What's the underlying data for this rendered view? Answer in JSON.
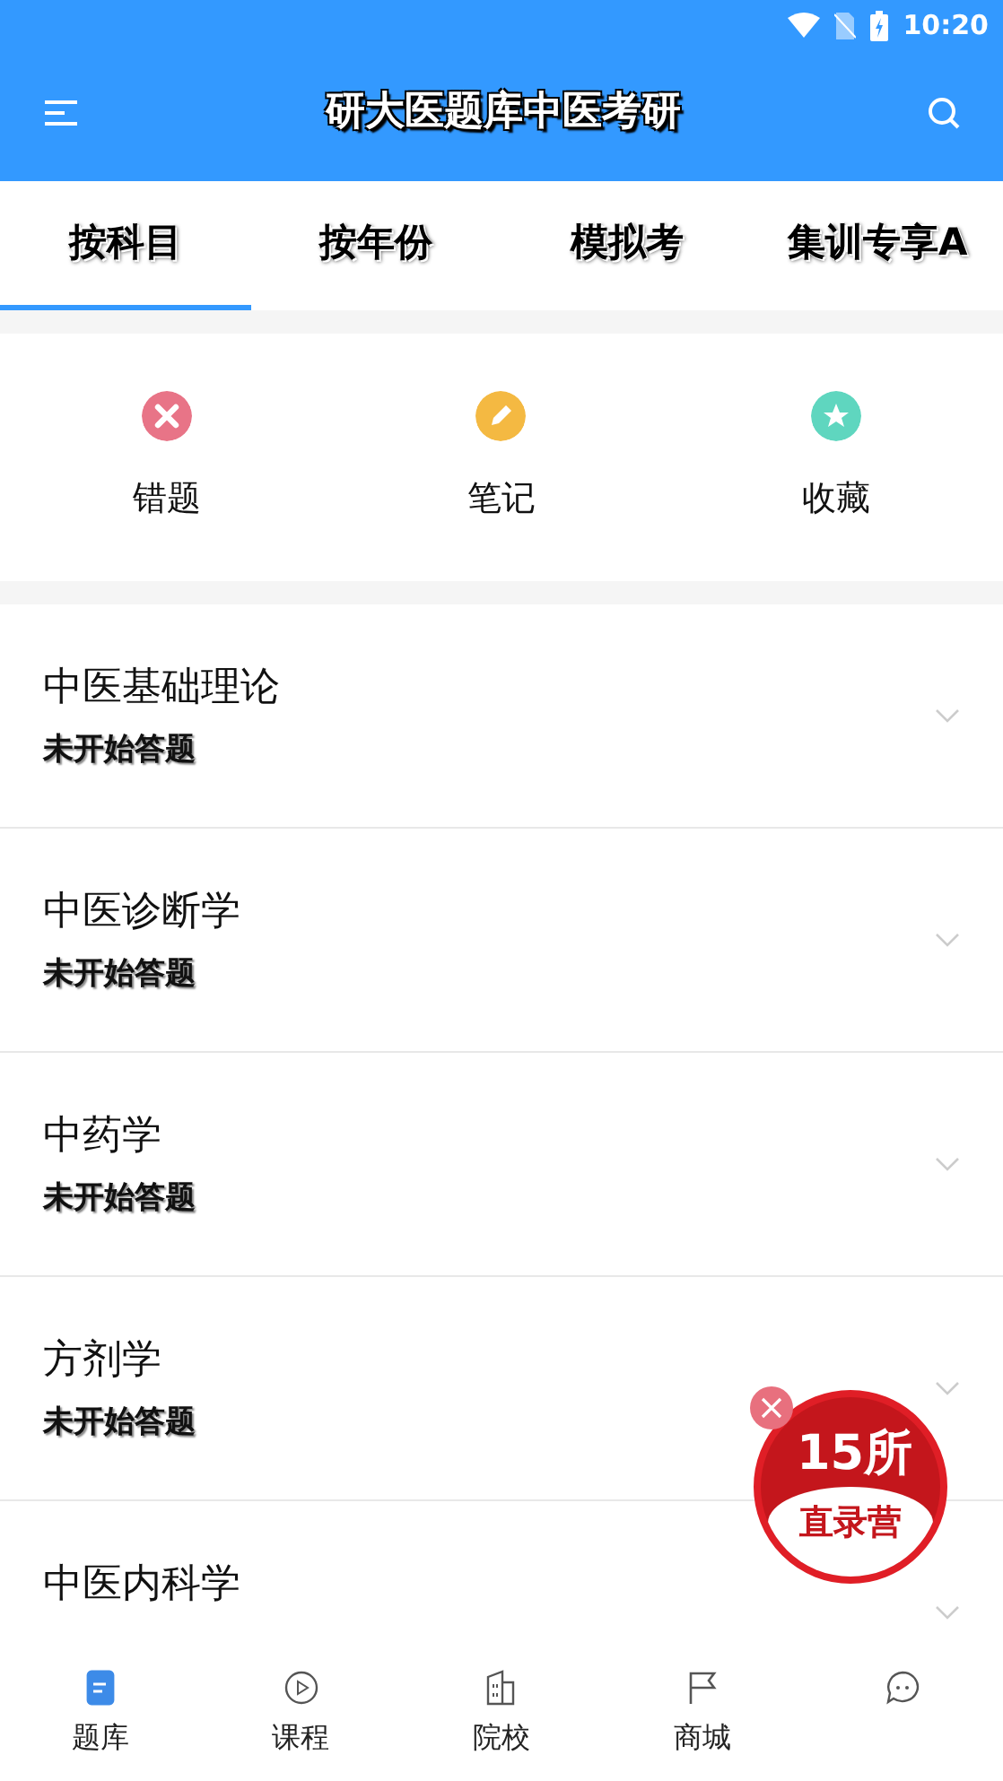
{
  "status_bar": {
    "time": "10:20"
  },
  "app_bar": {
    "title": "研大医题库中医考研"
  },
  "tabs": [
    {
      "label": "按科目",
      "selected": true
    },
    {
      "label": "按年份",
      "selected": false
    },
    {
      "label": "模拟考",
      "selected": false
    },
    {
      "label": "集训专享A",
      "selected": false
    }
  ],
  "shortcuts": [
    {
      "kind": "wrong",
      "label": "错题",
      "color": "#e87487"
    },
    {
      "kind": "note",
      "label": "笔记",
      "color": "#f4b942"
    },
    {
      "kind": "favorite",
      "label": "收藏",
      "color": "#5fd6bf"
    }
  ],
  "subjects": [
    {
      "name": "中医基础理论",
      "status": "未开始答题"
    },
    {
      "name": "中医诊断学",
      "status": "未开始答题"
    },
    {
      "name": "中药学",
      "status": "未开始答题"
    },
    {
      "name": "方剂学",
      "status": "未开始答题"
    },
    {
      "name": "中医内科学"
    }
  ],
  "promo": {
    "number": "15所",
    "caption": "直录营"
  },
  "bottom_nav": [
    {
      "kind": "bank",
      "label": "题库",
      "selected": true
    },
    {
      "kind": "course",
      "label": "课程",
      "selected": false
    },
    {
      "kind": "school",
      "label": "院校",
      "selected": false
    },
    {
      "kind": "shop",
      "label": "商城",
      "selected": false
    },
    {
      "kind": "chat",
      "selected": false
    }
  ]
}
